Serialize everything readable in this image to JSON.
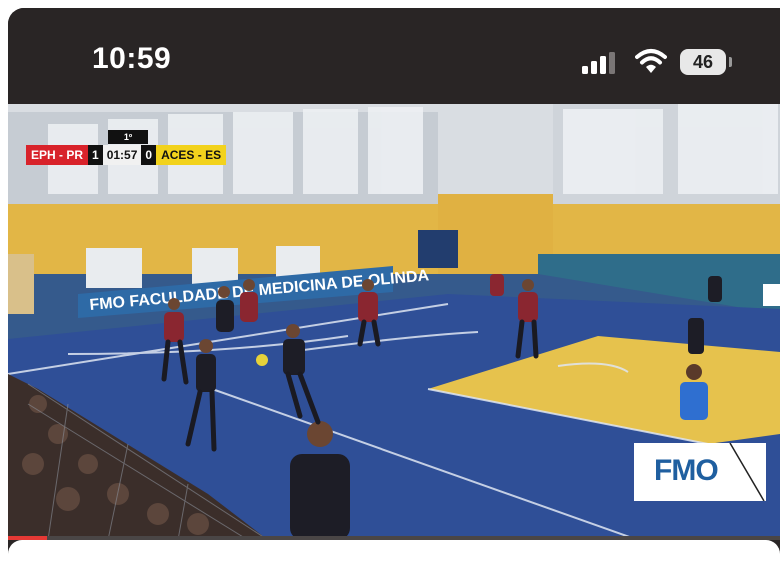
{
  "status_bar": {
    "time": "10:59",
    "battery_level": "46",
    "icons": [
      "cellular-signal-icon",
      "wifi-icon",
      "battery-icon"
    ]
  },
  "video": {
    "scoreboard": {
      "period": "1º TEMPO",
      "home_team": "EPH - PR",
      "home_score": "1",
      "clock": "01:57",
      "away_score": "0",
      "away_team": "ACES - ES"
    },
    "banner_text": "FMO  FACULDADE DE MEDICINA DE OLINDA",
    "watermark_logo": "FMO",
    "progress_fraction": 0.05
  },
  "colors": {
    "home_team": "#d8222a",
    "away_team": "#f2d21c",
    "court_blue": "#2f4f97",
    "court_yellow": "#e6c24d",
    "progress": "#e53935"
  }
}
